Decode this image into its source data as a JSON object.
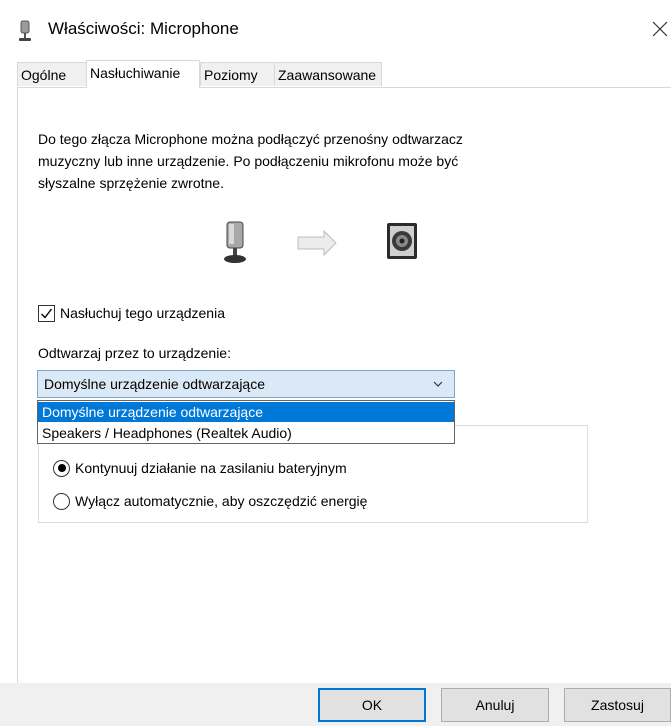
{
  "window": {
    "title": "Właściwości: Microphone",
    "icon": "microphone-icon"
  },
  "tabs": [
    {
      "label": "Ogólne",
      "active": false
    },
    {
      "label": "Nasłuchiwanie",
      "active": true
    },
    {
      "label": "Poziomy",
      "active": false
    },
    {
      "label": "Zaawansowane",
      "active": false
    }
  ],
  "listen": {
    "description_lines": [
      "Do tego złącza Microphone można podłączyć przenośny odtwarzacz",
      "muzyczny lub inne urządzenie. Po podłączeniu mikrofonu może być",
      "słyszalne sprzężenie zwrotne."
    ],
    "checkbox_label": "Nasłuchuj tego urządzenia",
    "checkbox_checked": true,
    "playback_label": "Odtwarzaj przez to urządzenie:",
    "selected_device": "Domyślne urządzenie odtwarzające",
    "dropdown_options": [
      "Domyślne urządzenie odtwarzające",
      "Speakers / Headphones (Realtek Audio)"
    ],
    "power_options": [
      {
        "label": "Kontynuuj działanie na zasilaniu bateryjnym",
        "selected": true
      },
      {
        "label": "Wyłącz automatycznie, aby oszczędzić energię",
        "selected": false
      }
    ]
  },
  "buttons": {
    "ok": "OK",
    "cancel": "Anuluj",
    "apply": "Zastosuj"
  },
  "colors": {
    "accent": "#0078d7",
    "select_bg": "#dbe8f6"
  }
}
